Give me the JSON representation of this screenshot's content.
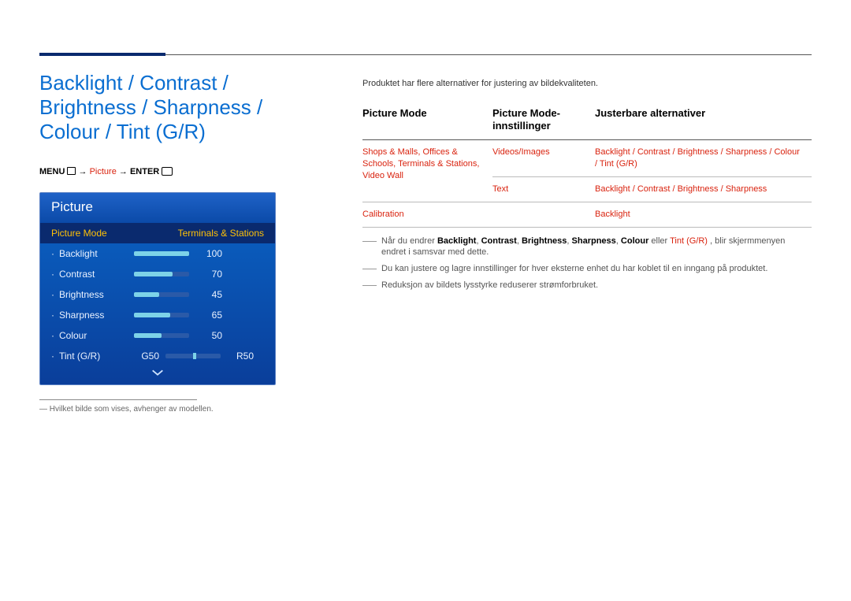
{
  "page_title": "Backlight / Contrast / Brightness / Sharpness / Colour / Tint (G/R)",
  "menu_path": {
    "menu": "MENU",
    "picture": "Picture",
    "enter": "ENTER"
  },
  "osd": {
    "title": "Picture",
    "selected_label": "Picture Mode",
    "selected_value": "Terminals & Stations",
    "rows": [
      {
        "label": "Backlight",
        "value": "100",
        "pct": 100
      },
      {
        "label": "Contrast",
        "value": "70",
        "pct": 70
      },
      {
        "label": "Brightness",
        "value": "45",
        "pct": 45
      },
      {
        "label": "Sharpness",
        "value": "65",
        "pct": 65
      },
      {
        "label": "Colour",
        "value": "50",
        "pct": 50
      }
    ],
    "tint": {
      "label": "Tint (G/R)",
      "left": "G50",
      "right": "R50",
      "pos": 50
    }
  },
  "footnote_small": "Hvilket bilde som vises, avhenger av modellen.",
  "intro": "Produktet har flere alternativer for justering av bildekvaliteten.",
  "table": {
    "headers": [
      "Picture Mode",
      "Picture Mode-innstillinger",
      "Justerbare alternativer"
    ],
    "rows": [
      {
        "mode": [
          "Shops & Malls",
          "Offices & Schools",
          "Terminals & Stations",
          "Video Wall"
        ],
        "setting": "Videos/Images",
        "adjust": [
          "Backlight",
          "Contrast",
          "Brightness",
          "Sharpness",
          "Colour",
          "Tint (G/R)"
        ]
      },
      {
        "mode": [],
        "setting": "Text",
        "adjust": [
          "Backlight",
          "Contrast",
          "Brightness",
          "Sharpness"
        ]
      },
      {
        "mode_single": "Calibration",
        "setting": "",
        "adjust": [
          "Backlight"
        ]
      }
    ]
  },
  "notes": {
    "n1_a": "Når du endrer ",
    "n1_terms": [
      "Backlight",
      "Contrast",
      "Brightness",
      "Sharpness",
      "Colour"
    ],
    "n1_or": " eller ",
    "n1_tint": "Tint (G/R)",
    "n1_b": ", blir skjermmenyen endret i samsvar med dette.",
    "n2": "Du kan justere og lagre innstillinger for hver eksterne enhet du har koblet til en inngang på produktet.",
    "n3": "Reduksjon av bildets lysstyrke reduserer strømforbruket."
  }
}
